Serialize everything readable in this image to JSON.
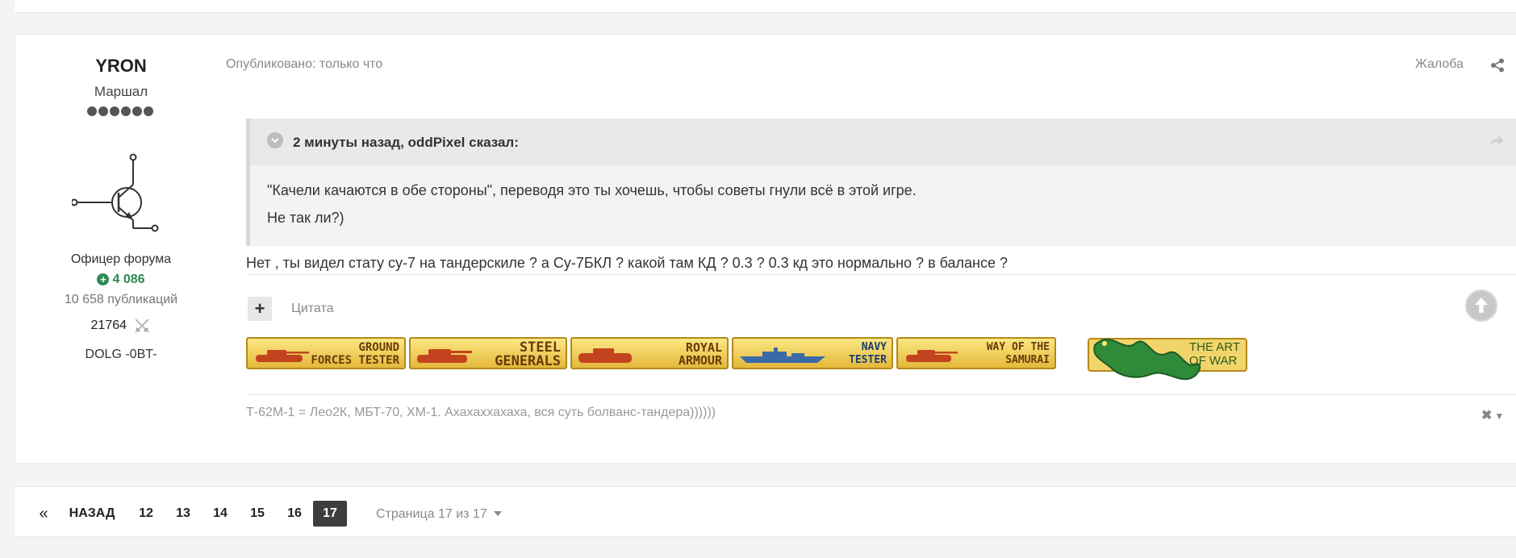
{
  "author": {
    "name": "YRON",
    "rank": "Маршал",
    "group": "Офицер форума",
    "reputation": "4 086",
    "posts": "10 658 публикаций",
    "battles": "21764",
    "clan": "DOLG -0BT-"
  },
  "post": {
    "published": "Опубликовано: только что",
    "report": "Жалоба",
    "quote": {
      "citation": "2 минуты назад, oddPixel сказал:",
      "line1": "\"Качели качаются в обе стороны\", переводя это ты хочешь, чтобы советы гнули всё в этой игре.",
      "line2": "Не так ли?)"
    },
    "text": "Нет , ты видел стату су-7 на тандерскиле ? а Су-7БКЛ ? какой там КД ? 0.3 ? 0.3 кд это нормально ? в балансе ?",
    "quote_button": "Цитата",
    "multiquote": "+",
    "badges": [
      {
        "line1": "GROUND",
        "line2": "FORCES TESTER",
        "vehicle": "tank-icon"
      },
      {
        "line1": "STEEL",
        "line2": "GENERALS",
        "vehicle": "tank-icon"
      },
      {
        "line1": "ROYAL",
        "line2": "ARMOUR",
        "vehicle": "tank-icon"
      },
      {
        "line1": "NAVY",
        "line2": "TESTER",
        "vehicle": "ship-icon"
      },
      {
        "line1": "WAY OF THE",
        "line2": "SAMURAI",
        "vehicle": "tank-icon"
      }
    ],
    "dragon_badge": {
      "line1": "THE ART",
      "line2": "OF WAR"
    },
    "signature": "Т-62М-1 = Лео2К,  МБТ-70,  ХМ-1.  Ахахаххахаха, вся суть болванс-тандера))))))"
  },
  "pagination": {
    "first": "«",
    "prev": "НАЗАД",
    "pages": [
      "12",
      "13",
      "14",
      "15",
      "16",
      "17"
    ],
    "current": "17",
    "info": "Страница 17 из 17"
  },
  "colors": {
    "reputation": "#2d8a56",
    "active_page": "#3d3d3d",
    "badge_gold": "#e4b83b"
  }
}
